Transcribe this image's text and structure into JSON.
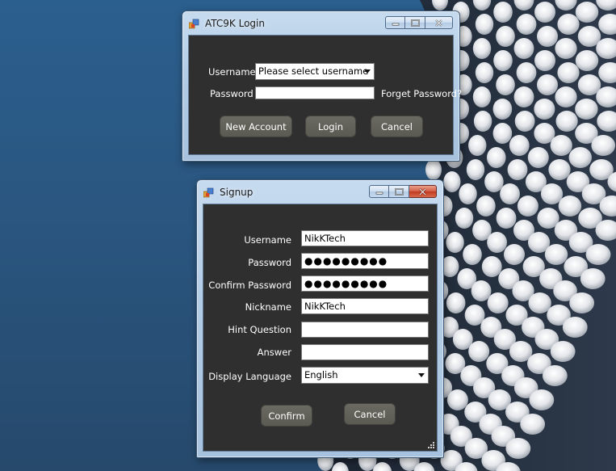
{
  "login_window": {
    "title": "ATC9K Login",
    "username_label": "Username",
    "username_selected": "Please select username",
    "password_label": "Password",
    "password_value": "",
    "forget_password_link": "Forget Password?",
    "new_account_button": "New Account",
    "login_button": "Login",
    "cancel_button": "Cancel"
  },
  "signup_window": {
    "title": "Signup",
    "fields": {
      "username": {
        "label": "Username",
        "value": "NikKTech"
      },
      "password": {
        "label": "Password",
        "value": "●●●●●●●●●"
      },
      "confirm_password": {
        "label": "Confirm Password",
        "value": "●●●●●●●●●"
      },
      "nickname": {
        "label": "Nickname",
        "value": "NikKTech"
      },
      "hint_question": {
        "label": "Hint Question",
        "value": ""
      },
      "answer": {
        "label": "Answer",
        "value": ""
      },
      "display_language": {
        "label": "Display Language",
        "value": "English"
      }
    },
    "confirm_button": "Confirm",
    "cancel_button": "Cancel"
  },
  "colors": {
    "client_background": "#2f2f2f",
    "button_background": "#5e5e57",
    "title_bar": "#b9d1ea",
    "close_button": "#c8442b",
    "desktop": "#2b5a86"
  },
  "icons": [
    "app-icon",
    "minimize-icon",
    "restore-icon",
    "close-icon",
    "dropdown-arrow-icon",
    "resize-grip-icon"
  ]
}
